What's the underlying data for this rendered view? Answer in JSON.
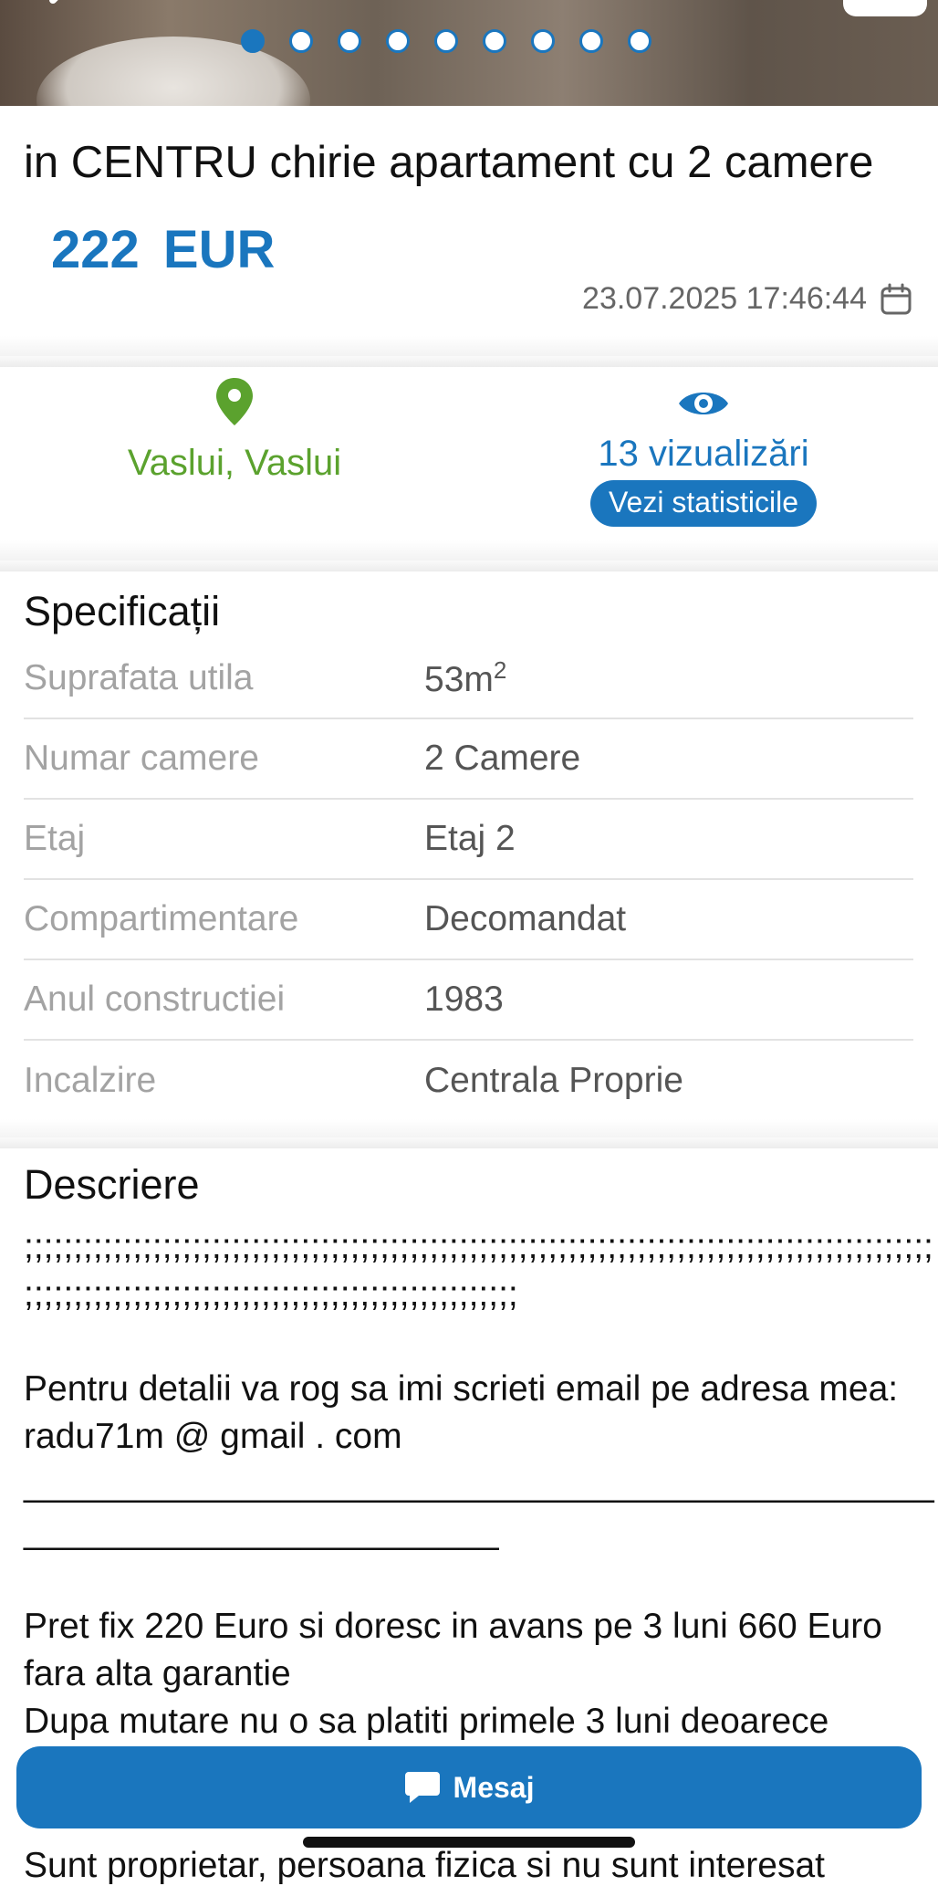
{
  "listing": {
    "title": "in CENTRU chirie apartament cu 2 camere",
    "price": "222 EUR",
    "date": "23.07.2025 17:46:44"
  },
  "gallery": {
    "dots_total": 9,
    "active_index": 0
  },
  "location": {
    "text": "Vaslui, Vaslui",
    "icon": "map-pin-icon"
  },
  "views": {
    "text": "13 vizualizări",
    "stats_button": "Vezi statisticile",
    "icon": "eye-icon"
  },
  "specs": {
    "title": "Specificații",
    "rows": [
      {
        "label": "Suprafata utila",
        "value": "53m",
        "sup": "2"
      },
      {
        "label": "Numar camere",
        "value": "2 Camere"
      },
      {
        "label": "Etaj",
        "value": "Etaj 2"
      },
      {
        "label": "Compartimentare",
        "value": "Decomandat"
      },
      {
        "label": "Anul constructiei",
        "value": "1983"
      },
      {
        "label": "Incalzire",
        "value": "Centrala Proprie"
      }
    ]
  },
  "description": {
    "title": "Descriere",
    "line1": ";;;;;;;;;;;;;;;;;;;;;;;;;;;;;;;;;;;;;;;;;;;;;;;;;;;;;;;;;;;;;;;;;;;;;;;;;;;;;;;;;;;;;;;;;;;;",
    "line2": ";;;;;;;;;;;;;;;;;;;;;;;;;;;;;;;;;;;;;;;;;;;;;;;;;;",
    "contact": "Pentru detalii va rog sa imi scrieti email pe adresa mea: radu71m @ gmail . com",
    "underscores1": "______________________________________________",
    "underscores2": "________________________",
    "price_terms": "Pret fix 220 Euro si doresc in avans pe 3 luni 660 Euro fara alta garantie",
    "after_move": "Dupa mutare nu o sa platiti primele 3 luni deoarece"
  },
  "actions": {
    "message_button": "Mesaj"
  },
  "bottom_partial_text": "Sunt proprietar, persoana fizica si nu sunt interesat"
}
